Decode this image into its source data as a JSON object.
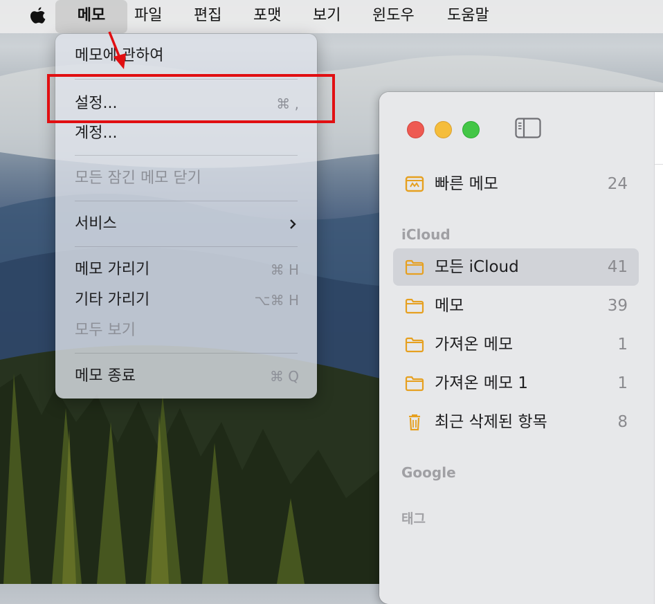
{
  "menubar": {
    "apple_icon": "apple-logo",
    "items": [
      "메모",
      "파일",
      "편집",
      "포맷",
      "보기",
      "윈도우",
      "도움말"
    ]
  },
  "app_menu": {
    "about": "메모에 관하여",
    "settings": "설정...",
    "settings_shortcut": "⌘ ,",
    "accounts": "계정...",
    "close_locked": "모든 잠긴 메모 닫기",
    "services": "서비스",
    "hide": "메모 가리기",
    "hide_shortcut": "⌘ H",
    "hide_others": "기타 가리기",
    "hide_others_shortcut": "⌥⌘ H",
    "show_all": "모두 보기",
    "quit": "메모 종료",
    "quit_shortcut": "⌘ Q"
  },
  "sidebar": {
    "quick_notes": {
      "label": "빠른 메모",
      "count": "24",
      "icon": "quick-note-icon"
    },
    "section_icloud": "iCloud",
    "icloud_folders": [
      {
        "label": "모든 iCloud",
        "count": "41",
        "icon": "folder-icon",
        "selected": true
      },
      {
        "label": "메모",
        "count": "39",
        "icon": "folder-icon"
      },
      {
        "label": "가져온 메모",
        "count": "1",
        "icon": "folder-icon"
      },
      {
        "label": "가져온 메모 1",
        "count": "1",
        "icon": "folder-icon"
      },
      {
        "label": "최근 삭제된 항목",
        "count": "8",
        "icon": "trash-icon"
      }
    ],
    "section_google": "Google",
    "section_tags": "태그"
  },
  "colors": {
    "highlight": "#e10f12",
    "folder": "#e6a020",
    "close": "#ee5a52",
    "minimize": "#f5bd3b",
    "maximize": "#43c646"
  }
}
